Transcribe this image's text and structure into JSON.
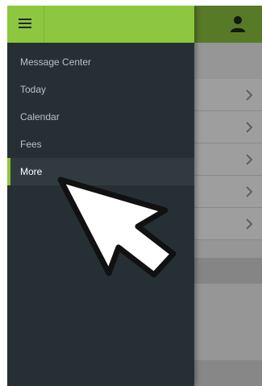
{
  "drawer": {
    "items": [
      {
        "label": "Message Center"
      },
      {
        "label": "Today"
      },
      {
        "label": "Calendar"
      },
      {
        "label": "Fees"
      },
      {
        "label": "More",
        "active": true
      }
    ]
  },
  "icons": {
    "menu": "hamburger-menu-icon",
    "profile": "person-icon",
    "row_chevron": "chevron-right-icon",
    "annotation": "arrow-cursor-icon"
  },
  "colors": {
    "accent": "#8dc63f",
    "drawer_bg": "#263034",
    "active_item_bg": "#313b3f"
  }
}
